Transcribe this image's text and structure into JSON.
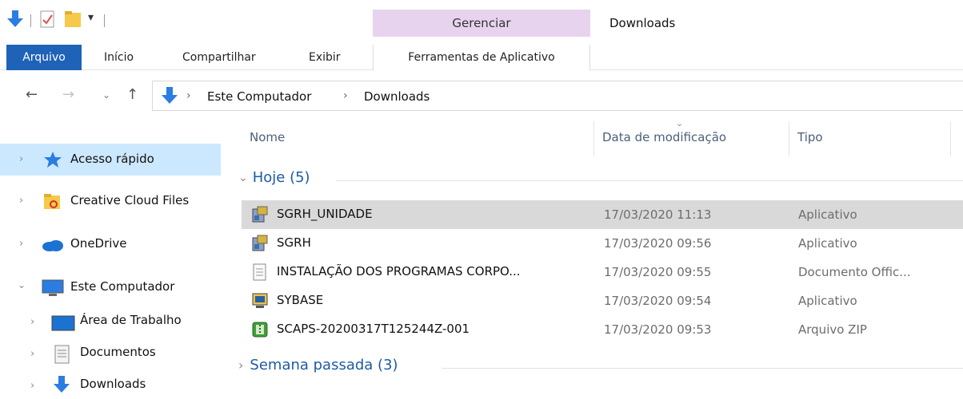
{
  "window": {
    "title": "Downloads",
    "context_group_title": "Gerenciar"
  },
  "ribbon": {
    "tabs": [
      {
        "label": "Arquivo"
      },
      {
        "label": "Início"
      },
      {
        "label": "Compartilhar"
      },
      {
        "label": "Exibir"
      },
      {
        "label": "Ferramentas de Aplicativo"
      }
    ]
  },
  "address": {
    "crumbs": [
      "Este Computador",
      "Downloads"
    ]
  },
  "sidebar": {
    "items": [
      {
        "label": "Acesso rápido",
        "icon": "star-icon",
        "selected": true
      },
      {
        "label": "Creative Cloud Files",
        "icon": "creative-cloud-folder-icon"
      },
      {
        "label": "OneDrive",
        "icon": "cloud-icon"
      },
      {
        "label": "Este Computador",
        "icon": "computer-icon",
        "expanded": true
      },
      {
        "label": "Área de Trabalho",
        "icon": "desktop-icon"
      },
      {
        "label": "Documentos",
        "icon": "documents-icon"
      },
      {
        "label": "Downloads",
        "icon": "download-arrow-icon"
      }
    ]
  },
  "columns": {
    "name": "Nome",
    "date": "Data de modificação",
    "type": "Tipo"
  },
  "groups": [
    {
      "label": "Hoje (5)"
    },
    {
      "label": "Semana passada (3)"
    }
  ],
  "files": [
    {
      "name": "SGRH_UNIDADE",
      "date": "17/03/2020 11:13",
      "type": "Aplicativo",
      "icon": "installer-icon",
      "selected": true
    },
    {
      "name": "SGRH",
      "date": "17/03/2020 09:56",
      "type": "Aplicativo",
      "icon": "installer-icon"
    },
    {
      "name": "INSTALAÇÃO DOS PROGRAMAS CORPO...",
      "date": "17/03/2020 09:55",
      "type": "Documento Offic...",
      "icon": "document-icon"
    },
    {
      "name": "SYBASE",
      "date": "17/03/2020 09:54",
      "type": "Aplicativo",
      "icon": "setup-icon"
    },
    {
      "name": "SCAPS-20200317T125244Z-001",
      "date": "17/03/2020 09:53",
      "type": "Arquivo ZIP",
      "icon": "zip-icon"
    }
  ]
}
